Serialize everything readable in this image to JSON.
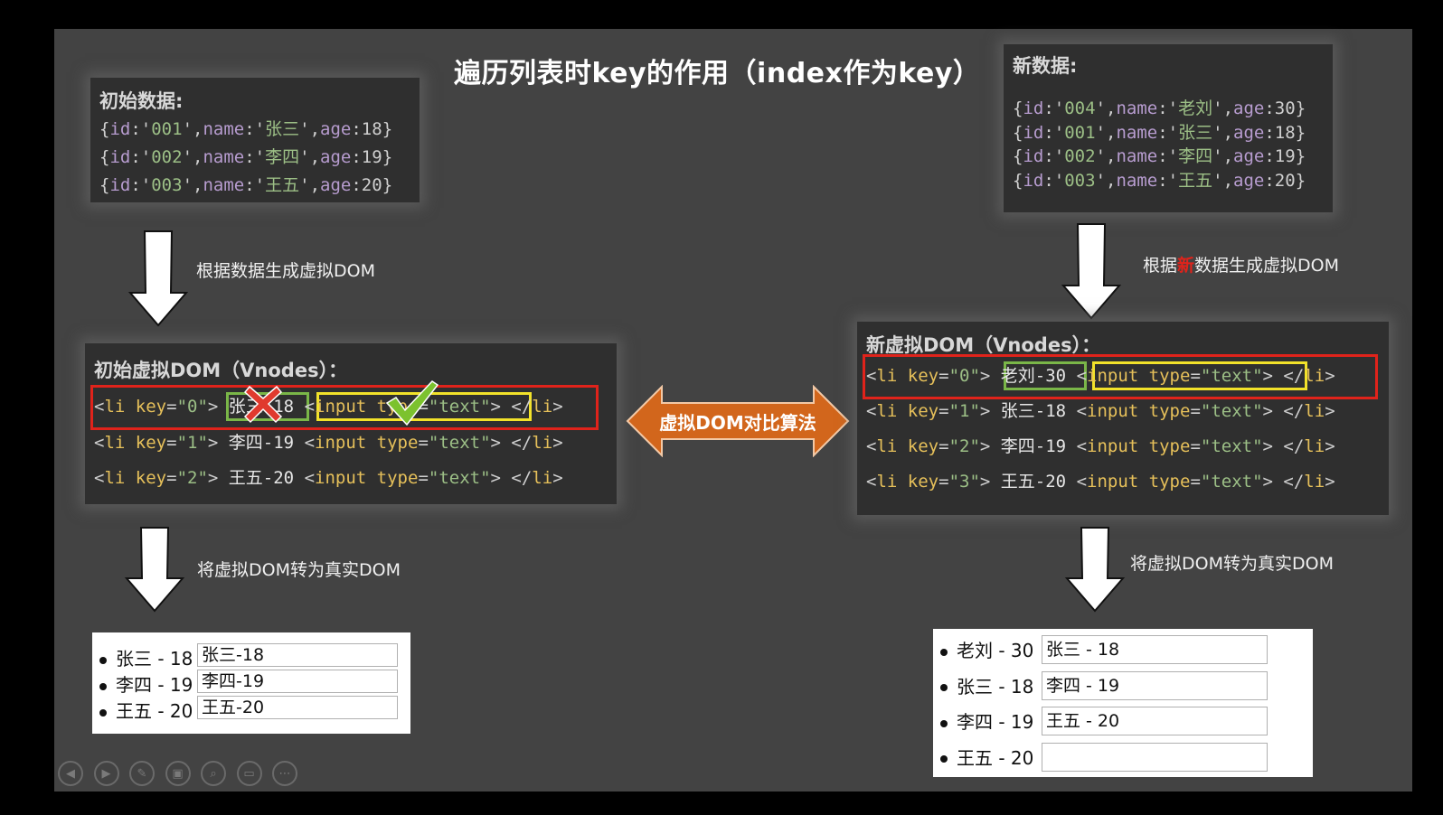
{
  "title": "遍历列表时key的作用（index作为key）",
  "initial_data": {
    "heading": "初始数据:",
    "rows": [
      {
        "id": "001",
        "name": "张三",
        "age": "18"
      },
      {
        "id": "002",
        "name": "李四",
        "age": "19"
      },
      {
        "id": "003",
        "name": "王五",
        "age": "20"
      }
    ]
  },
  "new_data": {
    "heading": "新数据:",
    "rows": [
      {
        "id": "004",
        "name": "老刘",
        "age": "30"
      },
      {
        "id": "001",
        "name": "张三",
        "age": "18"
      },
      {
        "id": "002",
        "name": "李四",
        "age": "19"
      },
      {
        "id": "003",
        "name": "王五",
        "age": "20"
      }
    ]
  },
  "code_tokens": {
    "id": "id",
    "name": "name",
    "age": "age",
    "li_open": "<li",
    "key_attr": "key=",
    "li_close_bracket": ">",
    "input_open": "<input",
    "type_attr": "type=",
    "type_value": "\"text\"",
    "input_close": ">",
    "li_end": "</li>"
  },
  "arrows": {
    "left_generate": "根据数据生成虚拟DOM",
    "right_generate_prefix": "根据",
    "right_generate_highlight": "新",
    "right_generate_suffix": "数据生成虚拟DOM",
    "left_render": "将虚拟DOM转为真实DOM",
    "right_render": "将虚拟DOM转为真实DOM",
    "diff": "虚拟DOM对比算法"
  },
  "initial_vdom": {
    "heading": "初始虚拟DOM（Vnodes）：",
    "rows": [
      {
        "key": "0",
        "text": "张三-18"
      },
      {
        "key": "1",
        "text": "李四-19"
      },
      {
        "key": "2",
        "text": "王五-20"
      }
    ],
    "marks": {
      "text_mismatch": "cross-icon",
      "input_reused": "check-icon"
    }
  },
  "new_vdom": {
    "heading": "新虚拟DOM（Vnodes）：",
    "rows": [
      {
        "key": "0",
        "text": "老刘-30"
      },
      {
        "key": "1",
        "text": "张三-18"
      },
      {
        "key": "2",
        "text": "李四-19"
      },
      {
        "key": "3",
        "text": "王五-20"
      }
    ]
  },
  "initial_real_dom": [
    {
      "label": "张三 - 18",
      "input_value": "张三-18"
    },
    {
      "label": "李四 - 19",
      "input_value": "李四-19"
    },
    {
      "label": "王五 - 20",
      "input_value": "王五-20"
    }
  ],
  "new_real_dom": [
    {
      "label": "老刘 - 30",
      "input_value": "张三 - 18"
    },
    {
      "label": "张三 - 18",
      "input_value": "李四 - 19"
    },
    {
      "label": "李四 - 19",
      "input_value": "王五 - 20"
    },
    {
      "label": "王五 - 20",
      "input_value": ""
    }
  ],
  "colors": {
    "highlight_row": "#e0231b",
    "text_box": "#7ab648",
    "input_box": "#f2e22a",
    "diff_arrow": "#d2661c",
    "emphasis": "#e0231b"
  },
  "slideshow_controls": [
    {
      "name": "previous-icon",
      "glyph": "◀"
    },
    {
      "name": "next-icon",
      "glyph": "▶"
    },
    {
      "name": "pen-icon",
      "glyph": "✎"
    },
    {
      "name": "slides-overview-icon",
      "glyph": "▣"
    },
    {
      "name": "zoom-icon",
      "glyph": "⌕"
    },
    {
      "name": "subtitles-icon",
      "glyph": "▭"
    },
    {
      "name": "more-icon",
      "glyph": "⋯"
    }
  ]
}
